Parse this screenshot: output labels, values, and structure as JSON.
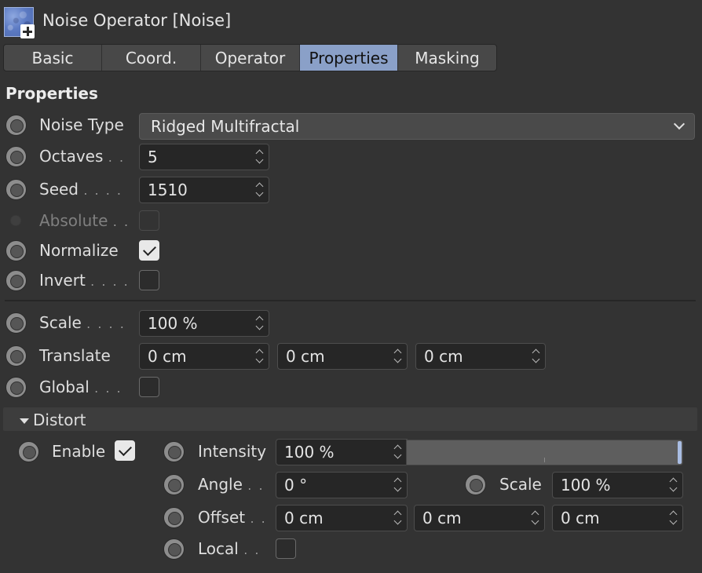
{
  "header": {
    "title": "Noise Operator [Noise]",
    "icon": "noise-operator-icon"
  },
  "tabs": [
    {
      "label": "Basic",
      "active": false
    },
    {
      "label": "Coord.",
      "active": false
    },
    {
      "label": "Operator",
      "active": false
    },
    {
      "label": "Properties",
      "active": true
    },
    {
      "label": "Masking",
      "active": false
    }
  ],
  "section": {
    "title": "Properties"
  },
  "properties": {
    "noise_type": {
      "label": "Noise Type",
      "value": "Ridged Multifractal"
    },
    "octaves": {
      "label": "Octaves",
      "dots": ". .",
      "value": "5"
    },
    "seed": {
      "label": "Seed",
      "dots": ". . . .",
      "value": "1510"
    },
    "absolute": {
      "label": "Absolute",
      "dots": ". .",
      "checked": false,
      "enabled": false
    },
    "normalize": {
      "label": "Normalize",
      "checked": true
    },
    "invert": {
      "label": "Invert",
      "dots": ". . . .",
      "checked": false
    },
    "scale": {
      "label": "Scale",
      "dots": ". . . .",
      "value": "100 %"
    },
    "translate": {
      "label": "Translate",
      "x": "0 cm",
      "y": "0 cm",
      "z": "0 cm"
    },
    "global": {
      "label": "Global",
      "dots": ". . .",
      "checked": false
    }
  },
  "distort": {
    "title": "Distort",
    "enable": {
      "label": "Enable",
      "checked": true
    },
    "intensity": {
      "label": "Intensity",
      "value": "100 %",
      "slider_fraction": 1.0
    },
    "angle": {
      "label": "Angle",
      "dots": ". .",
      "value": "0 °"
    },
    "scale": {
      "label": "Scale",
      "value": "100 %"
    },
    "offset": {
      "label": "Offset",
      "dots": ". .",
      "x": "0 cm",
      "y": "0 cm",
      "z": "0 cm"
    },
    "local": {
      "label": "Local",
      "dots": ". .",
      "checked": false
    }
  },
  "colors": {
    "accent_tab": "#8aa0c8",
    "background": "#333333",
    "slider_handle": "#a9bde3"
  }
}
